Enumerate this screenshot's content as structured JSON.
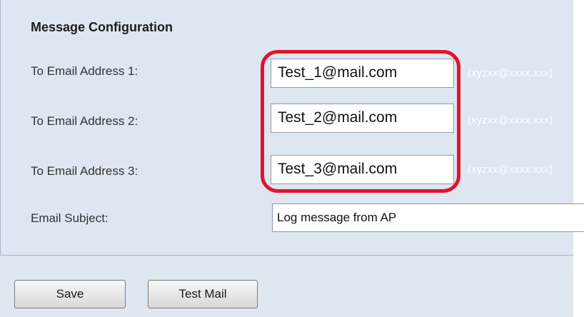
{
  "section": {
    "title": "Message Configuration"
  },
  "fields": [
    {
      "label": "To Email Address 1:",
      "value": "Test_1@mail.com",
      "hint": "(xyzxx@xxxx.xxx)"
    },
    {
      "label": "To Email Address 2:",
      "value": "Test_2@mail.com",
      "hint": "(xyzxx@xxxx.xxx)"
    },
    {
      "label": "To Email Address 3:",
      "value": "Test_3@mail.com",
      "hint": "(xyzxx@xxxx.xxx)"
    }
  ],
  "subject": {
    "label": "Email Subject:",
    "value": "Log message from AP"
  },
  "buttons": {
    "save_label": "Save",
    "test_mail_label": "Test Mail"
  },
  "colors": {
    "highlight": "#e3132c",
    "panel_bg": "#dde6f1"
  }
}
